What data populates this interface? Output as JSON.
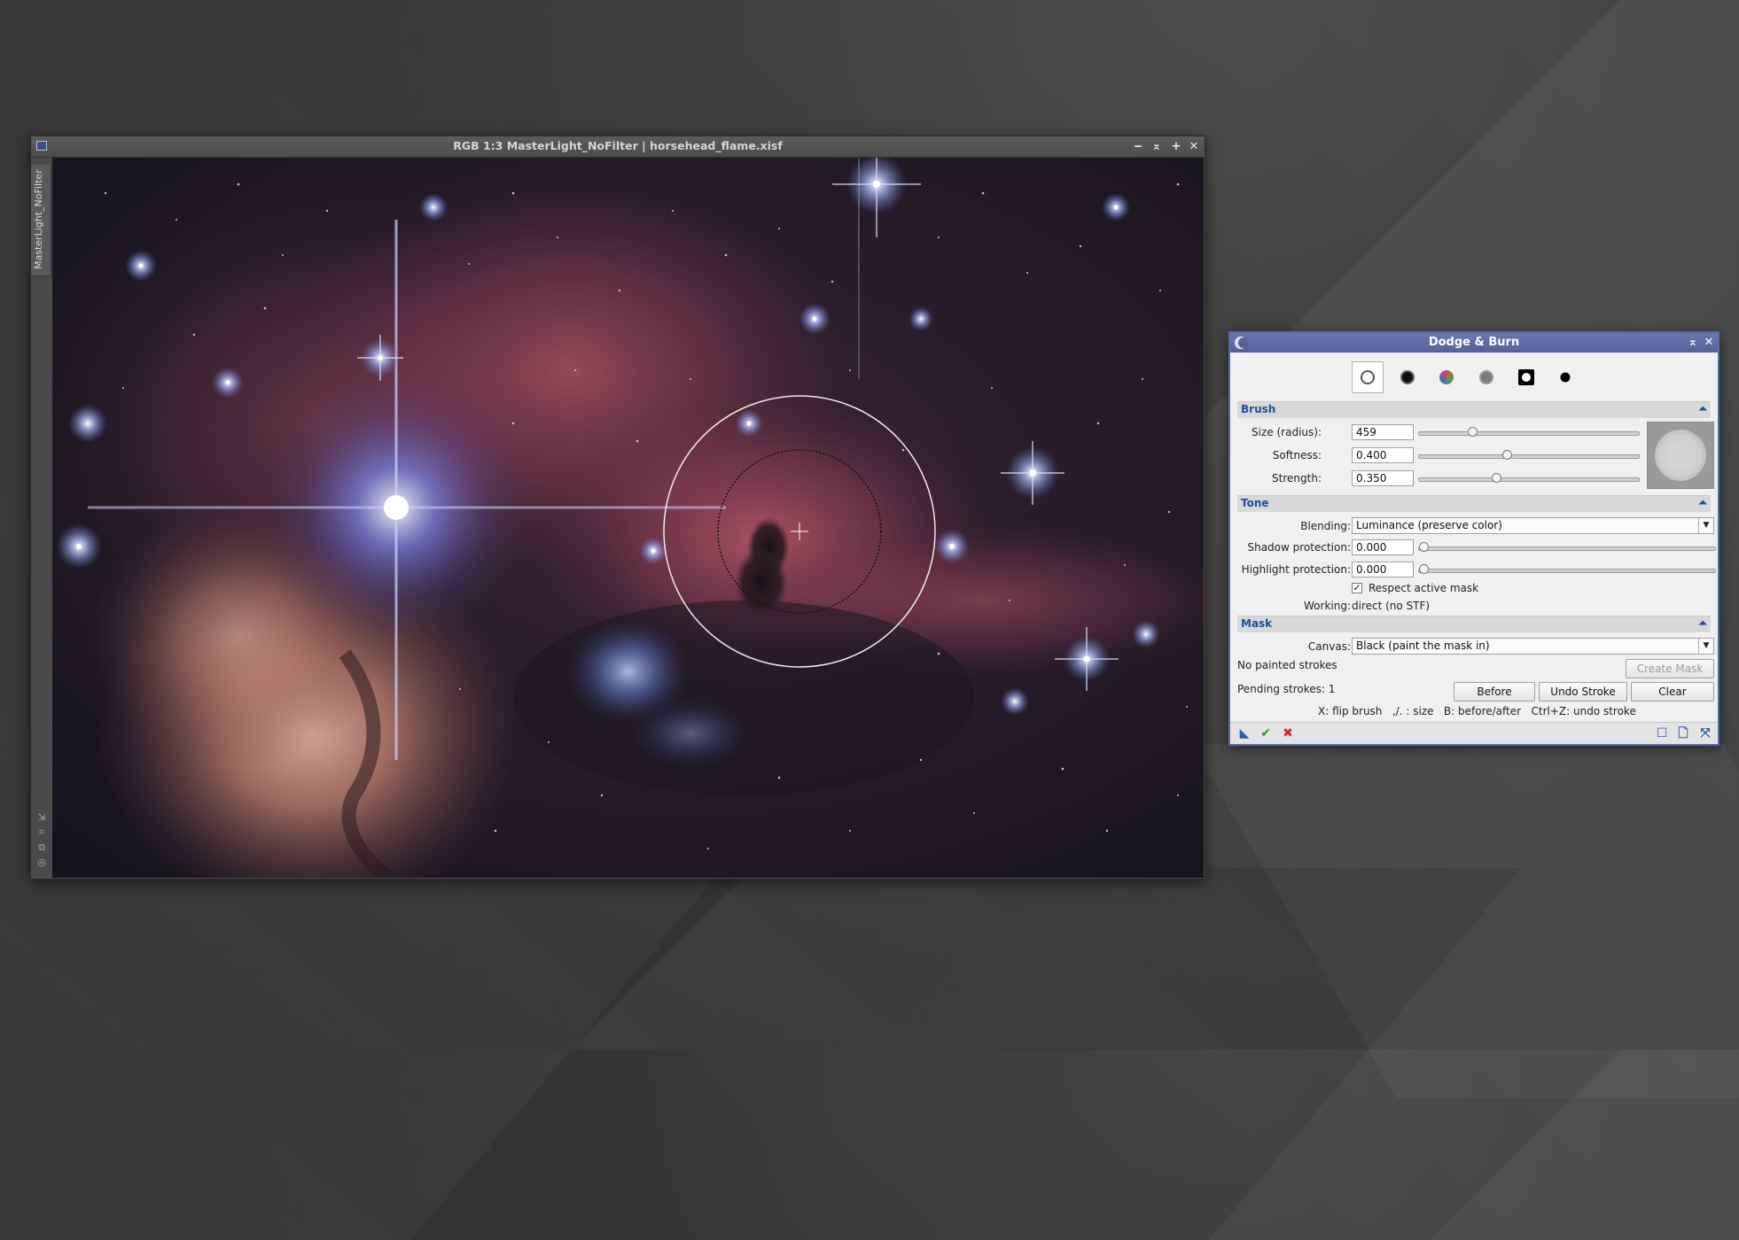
{
  "image_window": {
    "title": "RGB 1:3 MasterLight_NoFilter | horsehead_flame.xisf",
    "side_tab": "MasterLight_NoFilter",
    "title_buttons": [
      "‒",
      "⌅",
      "+",
      "✕"
    ]
  },
  "dodge_burn": {
    "title": "Dodge & Burn",
    "modes": [
      "dodge",
      "burn",
      "saturation",
      "desaturate",
      "mask-paint",
      "mask-erase"
    ],
    "selected_mode": "dodge",
    "brush": {
      "header": "Brush",
      "size_label": "Size (radius):",
      "size_value": "459",
      "size_fraction": 0.24,
      "softness_label": "Softness:",
      "softness_value": "0.400",
      "softness_fraction": 0.4,
      "strength_label": "Strength:",
      "strength_value": "0.350",
      "strength_fraction": 0.35
    },
    "tone": {
      "header": "Tone",
      "blending_label": "Blending:",
      "blending_value": "Luminance (preserve color)",
      "shadow_label": "Shadow protection:",
      "shadow_value": "0.000",
      "highlight_label": "Highlight protection:",
      "highlight_value": "0.000",
      "respect_mask_label": "Respect active mask",
      "respect_mask_checked": true,
      "working_label": "Working:",
      "working_value": "direct (no STF)"
    },
    "mask": {
      "header": "Mask",
      "canvas_label": "Canvas:",
      "canvas_value": "Black (paint the mask in)",
      "status": "No painted strokes",
      "create_mask": "Create Mask",
      "pending": "Pending strokes: 1",
      "before": "Before",
      "undo_stroke": "Undo Stroke",
      "clear": "Clear"
    },
    "hint": "X: flip brush   ,/. : size   B: before/after   Ctrl+Z: undo stroke",
    "section_collapse_glyph": "⏶",
    "bottom_icons": [
      "new-instance-icon",
      "apply-icon",
      "cancel-icon",
      "preferences-icon",
      "document-icon",
      "reset-icon"
    ]
  }
}
